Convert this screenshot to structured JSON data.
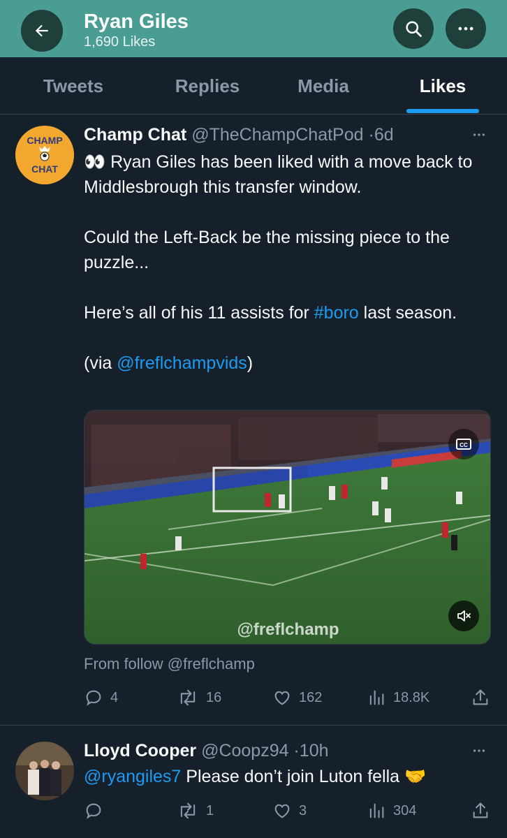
{
  "header": {
    "title": "Ryan Giles",
    "subtitle": "1,690 Likes",
    "back_icon": "arrow-left-icon",
    "search_icon": "search-icon",
    "more_icon": "more-horizontal-icon",
    "bg_color": "#4a9d92"
  },
  "tabs": [
    {
      "label": "Tweets"
    },
    {
      "label": "Replies"
    },
    {
      "label": "Media"
    },
    {
      "label": "Likes",
      "active": true
    }
  ],
  "tweets": [
    {
      "author": "Champ Chat",
      "handle": "@TheChampChatPod",
      "dot": "·",
      "time": "6d",
      "avatar_text_top": "CHAMP",
      "avatar_text_bottom": "CHAT",
      "emoji": "👀",
      "line1": " Ryan Giles has been liked with a move back to Middlesbrough this transfer window.",
      "para2": "Could the Left-Back be the missing piece to the puzzle...",
      "para3_pre": "Here’s all of his 11 assists for ",
      "para3_tag": "#boro",
      "para3_post": " last season.",
      "para4_pre": "(via ",
      "para4_mention": "@freflchampvids",
      "para4_post": ")",
      "video_watermark": "@freflchamp",
      "from_follow": "From follow @freflchamp",
      "stats": {
        "replies": "4",
        "retweets": "16",
        "likes": "162",
        "views": "18.8K"
      }
    },
    {
      "author": "Lloyd Cooper",
      "handle": "@Coopz94",
      "dot": "·",
      "time": "10h",
      "mention": "@ryangiles7",
      "text": " Please don’t join Luton fella ",
      "emoji": "🤝",
      "stats": {
        "replies": "",
        "retweets": "1",
        "likes": "3",
        "views": "304"
      }
    }
  ],
  "colors": {
    "accent": "#1d9bf0",
    "bg": "#15202b",
    "muted": "#8b98a5"
  }
}
